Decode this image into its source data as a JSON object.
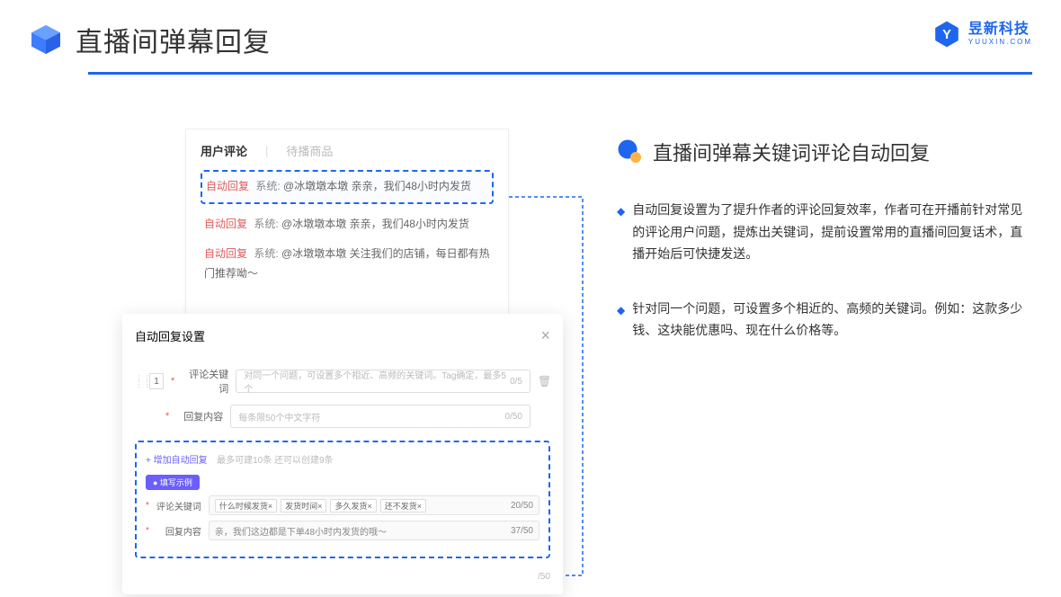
{
  "header": {
    "title": "直播间弹幕回复"
  },
  "brand": {
    "cn": "昱新科技",
    "en": "YUUXIN.COM"
  },
  "comments": {
    "tab_active": "用户评论",
    "tab_inactive": "待播商品",
    "items": [
      {
        "badge": "自动回复",
        "sys": "系统:",
        "txt": "@冰墩墩本墩 亲亲，我们48小时内发货"
      },
      {
        "badge": "自动回复",
        "sys": "系统:",
        "txt": "@冰墩墩本墩 亲亲，我们48小时内发货"
      },
      {
        "badge": "自动回复",
        "sys": "系统:",
        "txt": "@冰墩墩本墩 关注我们的店铺，每日都有热门推荐呦～"
      }
    ]
  },
  "modal": {
    "title": "自动回复设置",
    "seq": "1",
    "kw_label": "评论关键词",
    "kw_placeholder": "对同一个问题，可设置多个相近、高频的关键词。Tag确定，最多5个",
    "kw_count": "0/5",
    "content_label": "回复内容",
    "content_placeholder": "每条限50个中文字符",
    "content_count": "0/50",
    "add_link": "+ 增加自动回复",
    "add_hint": "最多可建10条 还可以创建9条",
    "example_pill": "● 填写示例",
    "ex_kw_label": "评论关键词",
    "ex_tags": [
      "什么时候发货×",
      "发货时间×",
      "多久发货×",
      "还不发货×"
    ],
    "ex_kw_count": "20/50",
    "ex_content_label": "回复内容",
    "ex_content_text": "亲，我们这边都是下单48小时内发货的哦～",
    "ex_content_count": "37/50",
    "tail_count": "/50"
  },
  "right": {
    "title": "直播间弹幕关键词评论自动回复",
    "b1": "自动回复设置为了提升作者的评论回复效率，作者可在开播前针对常见的评论用户问题，提炼出关键词，提前设置常用的直播间回复话术，直播开始后可快捷发送。",
    "b2": "针对同一个问题，可设置多个相近的、高频的关键词。例如：这款多少钱、这块能优惠吗、现在什么价格等。"
  }
}
